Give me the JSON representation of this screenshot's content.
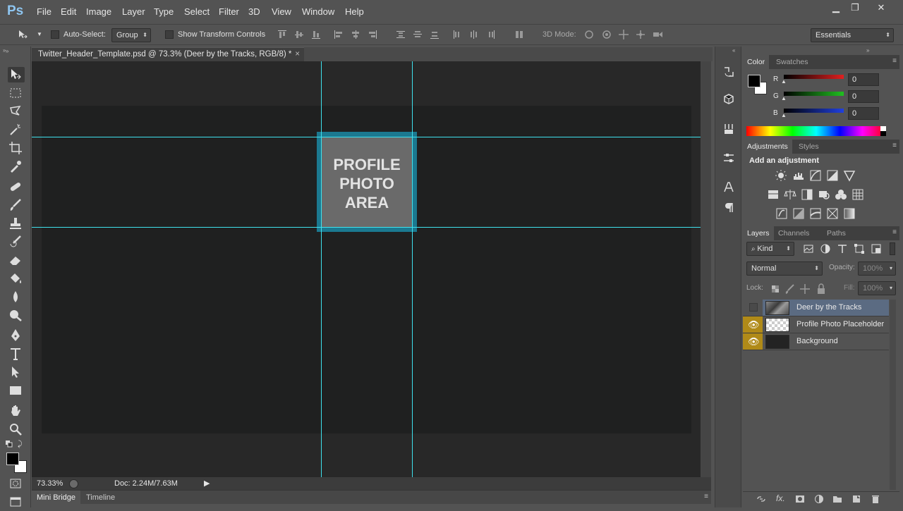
{
  "app": {
    "logo": "Ps"
  },
  "menu": [
    "File",
    "Edit",
    "Image",
    "Layer",
    "Type",
    "Select",
    "Filter",
    "3D",
    "View",
    "Window",
    "Help"
  ],
  "window_controls": {
    "minimize": "▁",
    "restore": "❐",
    "close": "✕"
  },
  "options": {
    "auto_select_label": "Auto-Select:",
    "auto_select_value": "Group",
    "transform_label": "Show Transform Controls",
    "mode_3d_label": "3D Mode:",
    "workspace": "Essentials"
  },
  "document": {
    "tab_title": "Twitter_Header_Template.psd @ 73.3% (Deer by the Tracks, RGB/8) *",
    "close": "×",
    "placeholder_text_line1": "PROFILE",
    "placeholder_text_line2": "PHOTO",
    "placeholder_text_line3": "AREA"
  },
  "status": {
    "zoom": "73.33%",
    "doc_size": "Doc: 2.24M/7.63M"
  },
  "bottom_tabs": [
    "Mini Bridge",
    "Timeline"
  ],
  "color_panel": {
    "tabs": [
      "Color",
      "Swatches"
    ],
    "channels": [
      {
        "label": "R",
        "value": "0",
        "color": "#e02020"
      },
      {
        "label": "G",
        "value": "0",
        "color": "#20c020"
      },
      {
        "label": "B",
        "value": "0",
        "color": "#2040e0"
      }
    ]
  },
  "adjustments_panel": {
    "tabs": [
      "Adjustments",
      "Styles"
    ],
    "heading": "Add an adjustment"
  },
  "layers_panel": {
    "tabs": [
      "Layers",
      "Channels",
      "Paths"
    ],
    "filter_kind": "Kind",
    "blend_mode": "Normal",
    "opacity_label": "Opacity:",
    "opacity_value": "100%",
    "lock_label": "Lock:",
    "fill_label": "Fill:",
    "fill_value": "100%",
    "layers": [
      {
        "name": "Deer by the Tracks",
        "visible": false,
        "selected": true
      },
      {
        "name": "Profile Photo Placeholder",
        "visible": true,
        "selected": false
      },
      {
        "name": "Background",
        "visible": true,
        "selected": false
      }
    ]
  },
  "colors": {
    "guide": "#3fe2ee",
    "profile_frame": "#1b8aa5",
    "eye_bg": "#b08a18",
    "selected_layer": "#5b6b82"
  }
}
